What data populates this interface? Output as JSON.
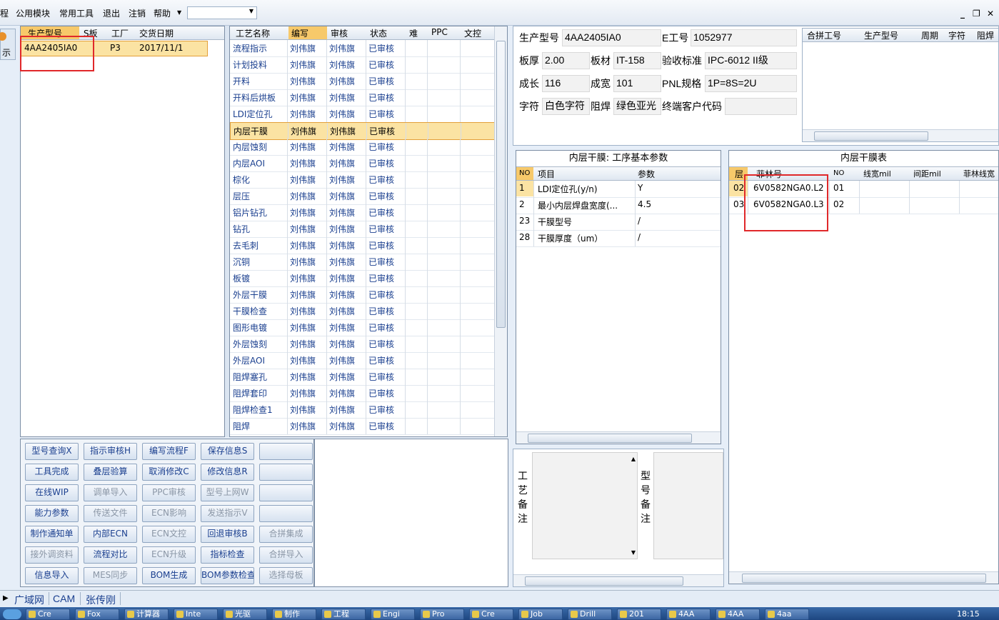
{
  "menu": {
    "items": [
      "程",
      "公用模块",
      "常用工具",
      "退出",
      "注销",
      "帮助"
    ],
    "combo_value": "",
    "win_controls": [
      "_",
      "❐",
      "✕"
    ]
  },
  "left_edge": {
    "label": "示"
  },
  "product_grid": {
    "headers": [
      "生产型号",
      "S板",
      "工厂",
      "交货日期"
    ],
    "rows": [
      [
        "4AA2405IA0",
        "",
        "P3",
        "2017/11/1"
      ]
    ]
  },
  "process_grid": {
    "headers": [
      "工艺名称",
      "编写",
      "审核",
      "状态",
      "难",
      "PPC",
      "文控"
    ],
    "rows": [
      [
        "流程指示",
        "刘伟旗",
        "刘伟旗",
        "已审核"
      ],
      [
        "计划投料",
        "刘伟旗",
        "刘伟旗",
        "已审核"
      ],
      [
        "开料",
        "刘伟旗",
        "刘伟旗",
        "已审核"
      ],
      [
        "开料后烘板",
        "刘伟旗",
        "刘伟旗",
        "已审核"
      ],
      [
        "LDI定位孔",
        "刘伟旗",
        "刘伟旗",
        "已审核"
      ],
      [
        "内层干膜",
        "刘伟旗",
        "刘伟旗",
        "已审核"
      ],
      [
        "内层蚀刻",
        "刘伟旗",
        "刘伟旗",
        "已审核"
      ],
      [
        "内层AOI",
        "刘伟旗",
        "刘伟旗",
        "已审核"
      ],
      [
        "棕化",
        "刘伟旗",
        "刘伟旗",
        "已审核"
      ],
      [
        "层压",
        "刘伟旗",
        "刘伟旗",
        "已审核"
      ],
      [
        "铝片钻孔",
        "刘伟旗",
        "刘伟旗",
        "已审核"
      ],
      [
        "钻孔",
        "刘伟旗",
        "刘伟旗",
        "已审核"
      ],
      [
        "去毛刺",
        "刘伟旗",
        "刘伟旗",
        "已审核"
      ],
      [
        "沉铜",
        "刘伟旗",
        "刘伟旗",
        "已审核"
      ],
      [
        "板镀",
        "刘伟旗",
        "刘伟旗",
        "已审核"
      ],
      [
        "外层干膜",
        "刘伟旗",
        "刘伟旗",
        "已审核"
      ],
      [
        "干膜检查",
        "刘伟旗",
        "刘伟旗",
        "已审核"
      ],
      [
        "图形电镀",
        "刘伟旗",
        "刘伟旗",
        "已审核"
      ],
      [
        "外层蚀刻",
        "刘伟旗",
        "刘伟旗",
        "已审核"
      ],
      [
        "外层AOI",
        "刘伟旗",
        "刘伟旗",
        "已审核"
      ],
      [
        "阻焊塞孔",
        "刘伟旗",
        "刘伟旗",
        "已审核"
      ],
      [
        "阻焊套印",
        "刘伟旗",
        "刘伟旗",
        "已审核"
      ],
      [
        "阻焊检查1",
        "刘伟旗",
        "刘伟旗",
        "已审核"
      ],
      [
        "阻焊",
        "刘伟旗",
        "刘伟旗",
        "已审核"
      ]
    ],
    "selected_row": 5
  },
  "buttons": [
    [
      "型号查询X",
      "指示审核H",
      "编写流程F",
      "保存信息S",
      ""
    ],
    [
      "工具完成",
      "叠层验算",
      "取消修改C",
      "修改信息R",
      ""
    ],
    [
      "在线WIP",
      "调单导入",
      "PPC审核",
      "型号上网W",
      ""
    ],
    [
      "能力参数",
      "传送文件",
      "ECN影响",
      "发送指示V",
      ""
    ],
    [
      "制作通知单",
      "内部ECN",
      "ECN文控",
      "回退审核B",
      "合拼集成"
    ],
    [
      "接外调资料",
      "流程对比",
      "ECN升级",
      "指标检查",
      "合拼导入"
    ],
    [
      "信息导入",
      "MES同步",
      "BOM生成",
      "BOM参数检查",
      "选择母板"
    ]
  ],
  "buttons_disabled": [
    [
      false,
      false,
      false,
      false,
      false
    ],
    [
      false,
      false,
      false,
      false,
      false
    ],
    [
      false,
      true,
      true,
      true,
      false
    ],
    [
      false,
      true,
      true,
      true,
      false
    ],
    [
      false,
      false,
      true,
      false,
      true
    ],
    [
      true,
      false,
      true,
      false,
      true
    ],
    [
      false,
      true,
      false,
      false,
      true
    ]
  ],
  "info": {
    "product_label": "生产型号",
    "product_value": "4AA2405IA0",
    "eno_label": "E工号",
    "eno_value": "1052977",
    "thick_label": "板厚",
    "thick_value": "2.00",
    "material_label": "板材",
    "material_value": "IT-158",
    "std_label": "验收标准",
    "std_value": "IPC-6012 II级",
    "len_label": "成长",
    "len_value": "116",
    "wid_label": "成宽",
    "wid_value": "101",
    "pnl_label": "PNL规格",
    "pnl_value": "1P=8S=2U",
    "char_label": "字符",
    "char_value": "白色字符",
    "mask_label": "阻焊",
    "mask_value": "绿色亚光",
    "cust_label": "终端客户代码",
    "cust_value": ""
  },
  "combine_grid": {
    "headers": [
      "合拼工号",
      "生产型号",
      "周期",
      "字符",
      "阻焊"
    ]
  },
  "params_panel": {
    "title": "内层干膜: 工序基本参数",
    "headers": [
      "NO",
      "项目",
      "参数"
    ],
    "rows": [
      [
        "1",
        "LDI定位孔(y/n)",
        "Y"
      ],
      [
        "2",
        "最小内层焊盘宽度(...",
        "4.5"
      ],
      [
        "23",
        "干膜型号",
        "/"
      ],
      [
        "28",
        "干膜厚度（um）",
        "/"
      ]
    ]
  },
  "film_panel": {
    "title": "内层干膜表",
    "headers": [
      "层",
      "菲林号",
      "NO",
      "线宽mil",
      "间距mil",
      "菲林线宽"
    ],
    "rows": [
      [
        "02",
        "6V0582NGA0.L2",
        "01"
      ],
      [
        "03",
        "6V0582NGA0.L3",
        "02"
      ]
    ]
  },
  "notes": {
    "process_label": [
      "工",
      "艺",
      "备",
      "注"
    ],
    "model_label": [
      "型",
      "号",
      "备",
      "注"
    ]
  },
  "status": [
    "广域网",
    "CAM",
    "张传刚"
  ],
  "taskbar": [
    "Cre",
    "Fox",
    "计算器",
    "Inte",
    "光驱",
    "制作",
    "工程",
    "Engi",
    "Pro",
    "Cre",
    "Job",
    "Drill",
    "201",
    "4AA",
    "4AA",
    "4aa"
  ],
  "clock": "18:15"
}
